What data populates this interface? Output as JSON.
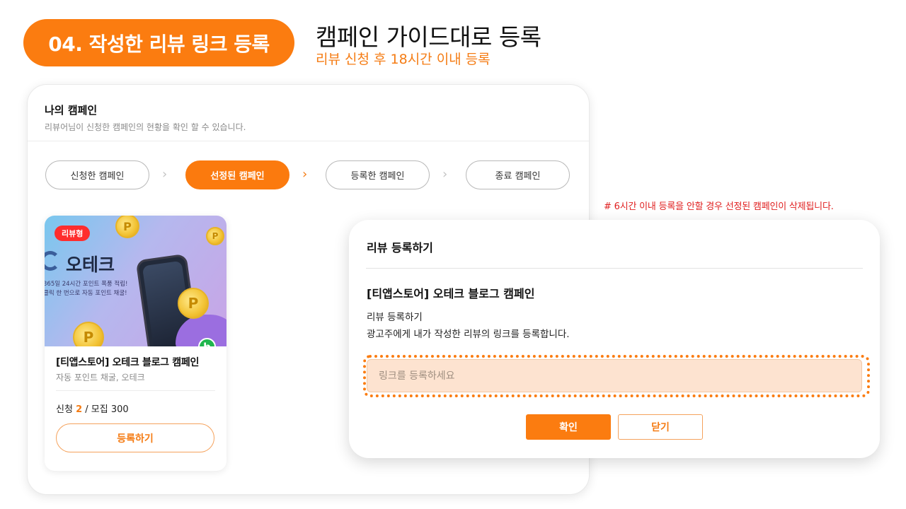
{
  "header": {
    "step_label": "04. 작성한 리뷰 링크 등록",
    "title": "캠페인 가이드대로 등록",
    "subtitle": "리뷰 신청 후 18시간 이내 등록"
  },
  "my_campaign": {
    "title": "나의 캠페인",
    "description": "리뷰어님이 신청한 캠페인의 현황을 확인 할 수 있습니다.",
    "tabs": [
      {
        "label": "신청한 캠페인",
        "active": false
      },
      {
        "label": "선정된 캠페인",
        "active": true
      },
      {
        "label": "등록한 캠페인",
        "active": false
      },
      {
        "label": "종료 캠페인",
        "active": false
      }
    ]
  },
  "campaign_card": {
    "type_badge": "리뷰형",
    "brand_name": "오테크",
    "promo_line1": "365일 24시간 포인트 폭풍 적립!",
    "promo_line2": "클릭 한 번으로 자동 포인트 채굴!",
    "platform_badge": "b",
    "name": "[티앱스토어] 오테크 블로그 캠페인",
    "tags": "자동 포인트 채굴, 오테크",
    "count_prefix": "신청",
    "applied": "2",
    "count_suffix": "/ 모집 300",
    "register_label": "등록하기"
  },
  "warning_note": "# 6시간 이내 등록을 안할 경우 선정된 캠페인이 삭제됩니다.",
  "modal": {
    "title": "리뷰 등록하기",
    "campaign_name": "[티앱스토어] 오테크 블로그 캠페인",
    "line1": "리뷰 등록하기",
    "line2": "광고주에게 내가 작성한 리뷰의 링크를 등록합니다.",
    "link_placeholder": "링크를 등록하세요",
    "confirm_label": "확인",
    "close_label": "닫기"
  },
  "colors": {
    "accent": "#fb7c10",
    "warning": "#e02020",
    "input_bg": "#fde3d0"
  }
}
